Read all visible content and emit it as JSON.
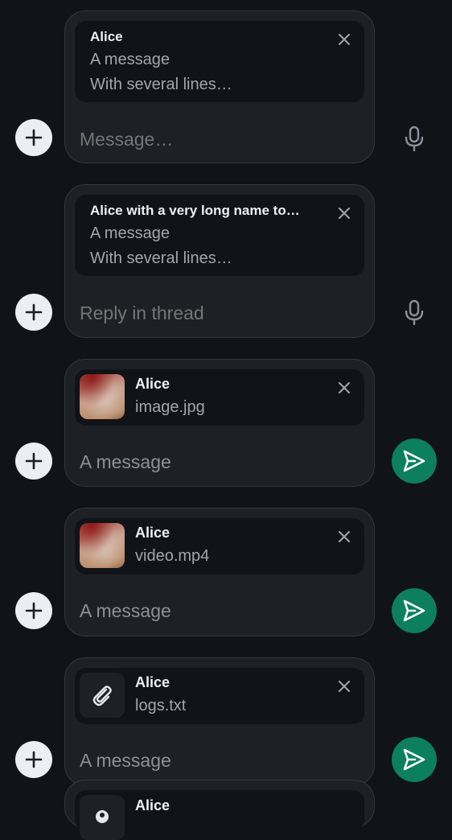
{
  "composers": [
    {
      "reply_name": "Alice",
      "reply_line1": "A message",
      "reply_line2": "With several lines…",
      "placeholder": "Message…",
      "action": "microphone"
    },
    {
      "reply_name": "Alice with a very long name to…",
      "reply_line1": "A message",
      "reply_line2": "With several lines…",
      "placeholder": "Reply in thread",
      "action": "microphone"
    },
    {
      "attachment_sender": "Alice",
      "attachment_file": "image.jpg",
      "attachment_type": "image",
      "input_text": "A message",
      "action": "send"
    },
    {
      "attachment_sender": "Alice",
      "attachment_file": "video.mp4",
      "attachment_type": "video",
      "input_text": "A message",
      "action": "send"
    },
    {
      "attachment_sender": "Alice",
      "attachment_file": "logs.txt",
      "attachment_type": "file",
      "input_text": "A message",
      "action": "send"
    },
    {
      "attachment_sender": "Alice"
    }
  ],
  "colors": {
    "background": "#101318",
    "composer_surface": "#1d2025",
    "send_button": "#0c7f5f",
    "add_button": "#ebeef2"
  }
}
